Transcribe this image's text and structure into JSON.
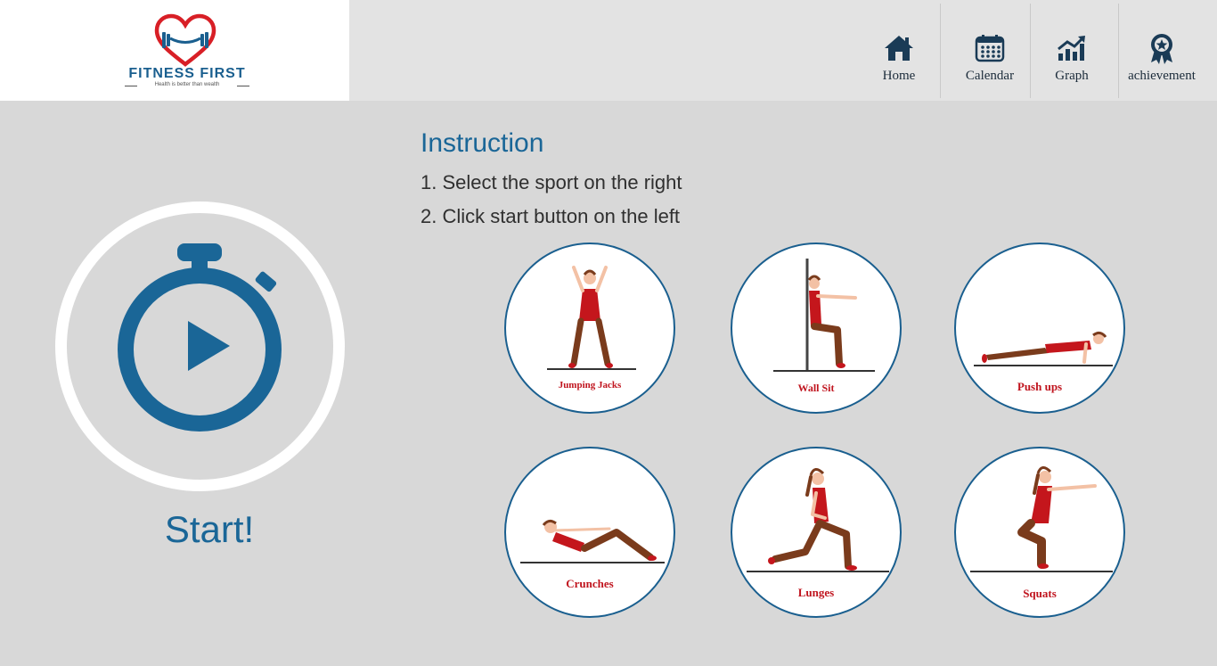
{
  "brand": {
    "title": "FITNESS FIRST",
    "tagline": "Health is better than wealth",
    "heart_color": "#d81f26",
    "accent_color": "#1a5f8f"
  },
  "nav": [
    {
      "label": "Home",
      "icon": "home-icon"
    },
    {
      "label": "Calendar",
      "icon": "calendar-icon"
    },
    {
      "label": "Graph",
      "icon": "graph-icon"
    },
    {
      "label": "achievement",
      "icon": "award-icon"
    }
  ],
  "timer": {
    "start_label": "Start!",
    "icon": "stopwatch-play-icon"
  },
  "instruction": {
    "title": "Instruction",
    "steps": [
      "1. Select the sport on the right",
      "2. Click start button on the left"
    ]
  },
  "exercises": [
    {
      "label": "Jumping Jacks"
    },
    {
      "label": "Wall  Sit"
    },
    {
      "label": "Push ups"
    },
    {
      "label": "Crunches"
    },
    {
      "label": "Lunges"
    },
    {
      "label": "Squats"
    }
  ]
}
